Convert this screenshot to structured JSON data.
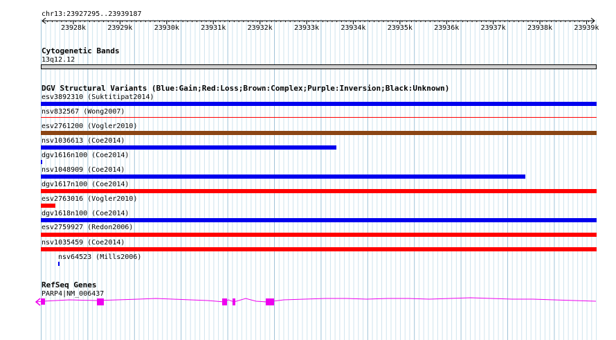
{
  "locus": "chr13:23927295..23939187",
  "ruler": {
    "ticks": [
      "23928k",
      "23929k",
      "23930k",
      "23931k",
      "23932k",
      "23933k",
      "23934k",
      "23935k",
      "23936k",
      "23937k",
      "23938k",
      "23939k"
    ]
  },
  "cytoband": {
    "title": "Cytogenetic Bands",
    "label": "13q12.12"
  },
  "dgv": {
    "title": "DGV Structural Variants (Blue:Gain;Red:Loss;Brown:Complex;Purple:Inversion;Black:Unknown)",
    "colors": {
      "gain": "#0000ee",
      "loss": "#ff0000",
      "complex": "#8b4513",
      "unknown": "#000000"
    },
    "features": [
      {
        "label": "esv3892310 (Suktitipat2014)",
        "type": "gain"
      },
      {
        "label": "nsv832567 (Wong2007)",
        "type": "loss"
      },
      {
        "label": "esv2761200 (Vogler2010)",
        "type": "complex"
      },
      {
        "label": "nsv1036613 (Coe2014)",
        "type": "gain"
      },
      {
        "label": "dgv1616n100 (Coe2014)",
        "type": "gain"
      },
      {
        "label": "nsv1048909 (Coe2014)",
        "type": "gain"
      },
      {
        "label": "dgv1617n100 (Coe2014)",
        "type": "loss"
      },
      {
        "label": "esv2763016 (Vogler2010)",
        "type": "loss"
      },
      {
        "label": "dgv1618n100 (Coe2014)",
        "type": "gain"
      },
      {
        "label": "esv2759927 (Redon2006)",
        "type": "loss"
      },
      {
        "label": "nsv1035459 (Coe2014)",
        "type": "loss"
      },
      {
        "label": "nsv64523 (Mills2006)",
        "type": "gain"
      }
    ]
  },
  "refseq": {
    "title": "RefSeq Genes",
    "gene_label": "PARP4|NM_006437",
    "color": "#ee00ee"
  }
}
